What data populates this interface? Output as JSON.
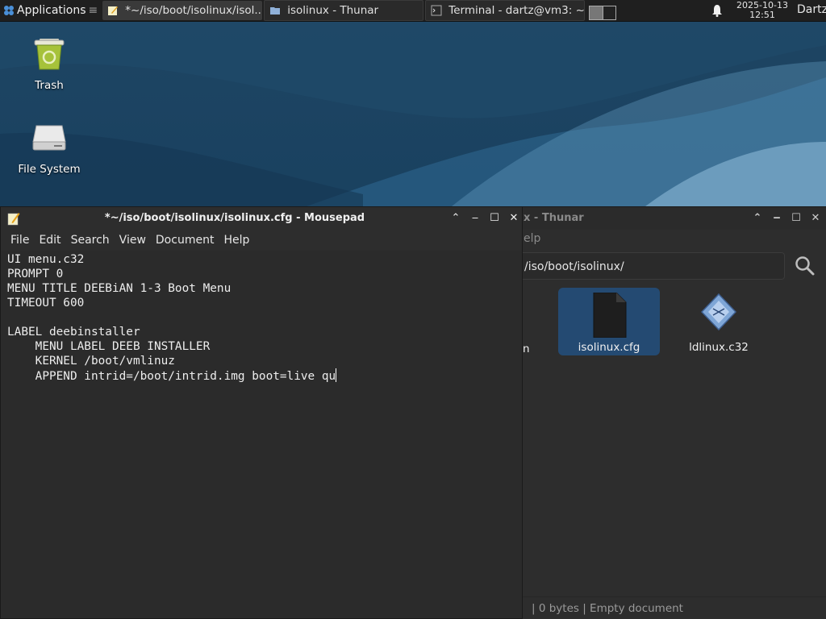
{
  "panel": {
    "applications_label": "Applications",
    "tasks": [
      {
        "label": "*~/iso/boot/isolinux/isol...",
        "icon": "mousepad-icon",
        "active": true
      },
      {
        "label": "isolinux - Thunar",
        "icon": "folder-icon",
        "active": false
      },
      {
        "label": "Terminal - dartz@vm3: ~",
        "icon": "terminal-icon",
        "active": false
      }
    ],
    "clock_date": "2025-10-13",
    "clock_time": "12:51",
    "user": "Dartz"
  },
  "desktop": {
    "icons": [
      {
        "label": "Trash",
        "icon": "trash-icon"
      },
      {
        "label": "File System",
        "icon": "drive-icon"
      }
    ]
  },
  "thunar": {
    "title": "x - Thunar",
    "menu_fragment": "elp",
    "path": "/iso/boot/isolinux/",
    "partial_file_label": "n",
    "files": [
      {
        "label": "isolinux.cfg",
        "icon": "text-file-icon",
        "selected": true
      },
      {
        "label": "ldlinux.c32",
        "icon": "binary-file-icon",
        "selected": false
      }
    ],
    "status": "|  0 bytes  |  Empty document"
  },
  "mousepad": {
    "title": "*~/iso/boot/isolinux/isolinux.cfg - Mousepad",
    "menu": [
      "File",
      "Edit",
      "Search",
      "View",
      "Document",
      "Help"
    ],
    "lines": [
      "UI menu.c32",
      "PROMPT 0",
      "MENU TITLE DEEBiAN 1-3 Boot Menu",
      "TIMEOUT 600",
      "",
      "LABEL deebinstaller",
      "    MENU LABEL DEEB INSTALLER",
      "    KERNEL /boot/vmlinuz",
      "    APPEND intrid=/boot/intrid.img boot=live qu"
    ]
  },
  "colors": {
    "panel_bg": "#1f1f1f",
    "window_bg": "#2d2d2d",
    "selection": "#244a72",
    "wallpaper": "#1c3f5e"
  }
}
